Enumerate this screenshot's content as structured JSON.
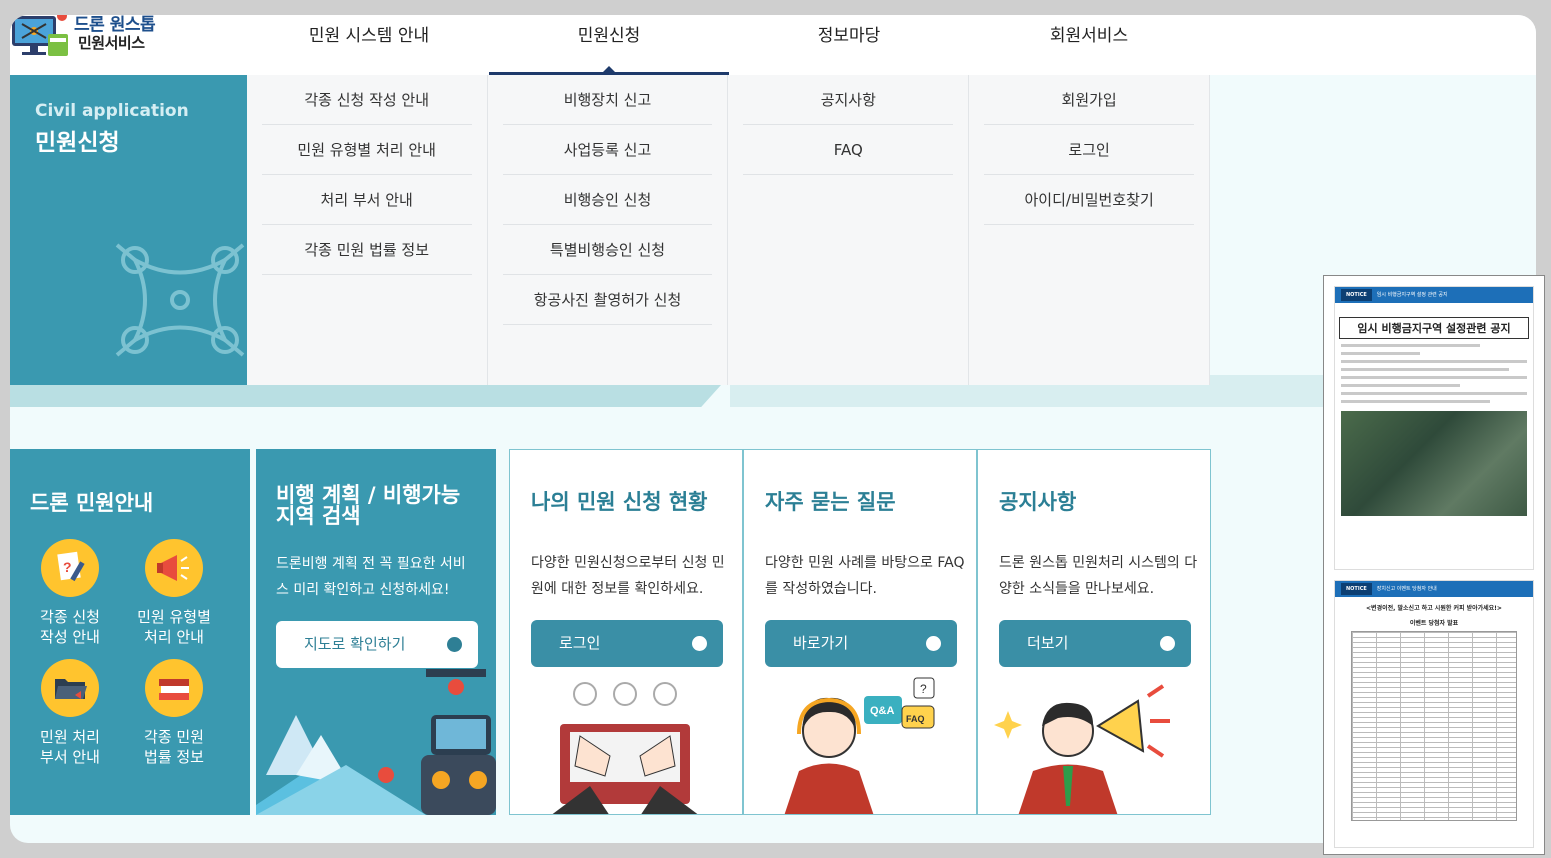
{
  "logo": {
    "line1": "드론 원스톱",
    "line2": "민원서비스"
  },
  "gnb": [
    {
      "label": "민원 시스템 안내"
    },
    {
      "label": "민원신청"
    },
    {
      "label": "정보마당"
    },
    {
      "label": "회원서비스"
    }
  ],
  "mega": {
    "en": "Civil application",
    "ko": "민원신청",
    "cols": [
      [
        "각종 신청 작성 안내",
        "민원 유형별 처리 안내",
        "처리 부서 안내",
        "각종 민원 법률 정보"
      ],
      [
        "비행장치 신고",
        "사업등록 신고",
        "비행승인 신청",
        "특별비행승인 신청",
        "항공사진 촬영허가 신청"
      ],
      [
        "공지사항",
        "FAQ"
      ],
      [
        "회원가입",
        "로그인",
        "아이디/비밀번호찾기"
      ]
    ]
  },
  "guide": {
    "title": "드론 민원안내",
    "items": [
      {
        "line1": "각종 신청",
        "line2": "작성 안내"
      },
      {
        "line1": "민원 유형별",
        "line2": "처리 안내"
      },
      {
        "line1": "민원 처리",
        "line2": "부서 안내"
      },
      {
        "line1": "각종 민원",
        "line2": "법률 정보"
      }
    ]
  },
  "map": {
    "title": "비행 계획 / 비행가능 지역 검색",
    "desc": "드론비행 계획 전 꼭 필요한 서비스 미리 확인하고 신청하세요!",
    "button": "지도로 확인하기"
  },
  "services": [
    {
      "title": "나의 민원 신청 현황",
      "desc": "다양한 민원신청으로부터 신청 민원에 대한 정보를 확인하세요.",
      "button": "로그인"
    },
    {
      "title": "자주 묻는 질문",
      "desc": "다양한 민원 사례를 바탕으로 FAQ를 작성하였습니다.",
      "button": "바로가기"
    },
    {
      "title": "공지사항",
      "desc": "드론 원스톱 민원처리 시스템의 다양한 소식들을 만나보세요.",
      "button": "더보기"
    }
  ],
  "notice": {
    "doc1": {
      "tag": "NOTICE",
      "head": "임시 비행금지구역 설정 관련 공지",
      "title": "임시 비행금지구역 설정관련 공지"
    },
    "doc2": {
      "tag": "NOTICE",
      "head": "장치신고 이벤트 당첨자 안내",
      "sub1": "<변경이전, 말소신고 하고 시원한 커피 받아가세요!>",
      "sub2": "이벤트 당첨자 발표"
    }
  },
  "colors": {
    "primary": "#3a99b0",
    "navy": "#1e3a6b",
    "accent": "#ffc42e"
  }
}
